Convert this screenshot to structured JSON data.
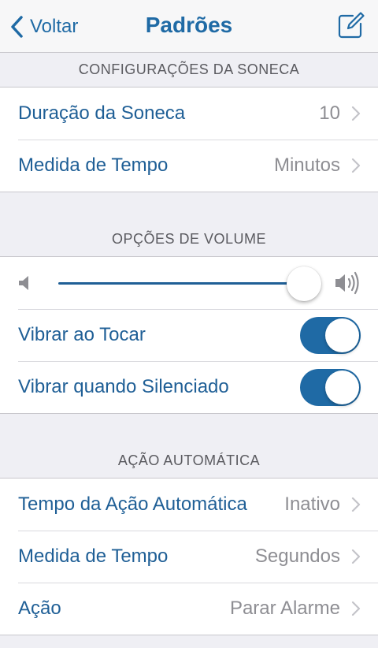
{
  "navbar": {
    "back_label": "Voltar",
    "title": "Padrões",
    "compose_icon": "compose-icon"
  },
  "snooze": {
    "header": "CONFIGURAÇÕES DA SONECA",
    "rows": [
      {
        "label": "Duração da Soneca",
        "value": "10"
      },
      {
        "label": "Medida de Tempo",
        "value": "Minutos"
      }
    ]
  },
  "volume": {
    "header": "OPÇÕES DE VOLUME",
    "level": 1.0,
    "toggles": [
      {
        "label": "Vibrar ao Tocar",
        "on": true
      },
      {
        "label": "Vibrar quando Silenciado",
        "on": true
      }
    ]
  },
  "auto_action": {
    "header": "AÇÃO AUTOMÁTICA",
    "rows": [
      {
        "label": "Tempo da Ação Automática",
        "value": "Inativo"
      },
      {
        "label": "Medida de Tempo",
        "value": "Segundos"
      },
      {
        "label": "Ação",
        "value": "Parar Alarme"
      }
    ]
  },
  "colors": {
    "accent": "#1f6aa5",
    "background": "#efeff4",
    "secondary_text": "#8e8e93"
  }
}
